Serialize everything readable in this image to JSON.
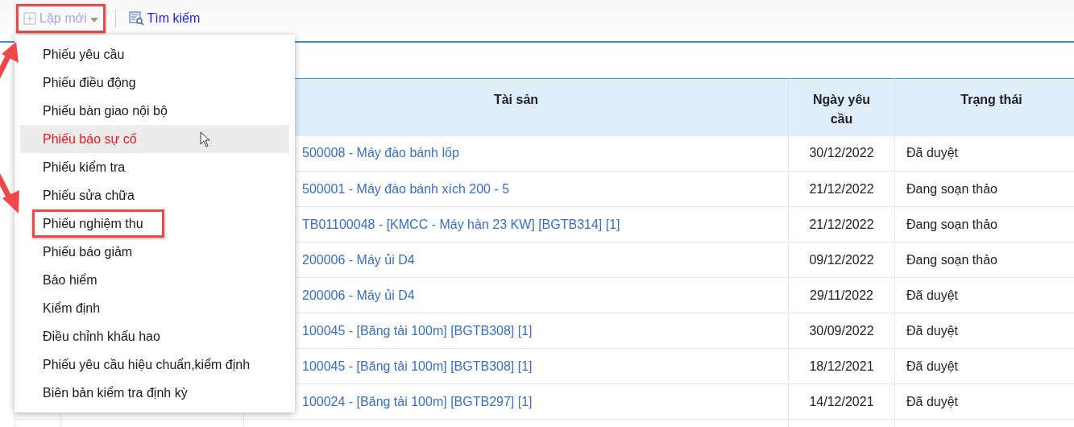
{
  "toolbar": {
    "buttons": [
      {
        "label": "Lập mới",
        "kind": "dropdown",
        "expanded": true,
        "annotated": true
      },
      {
        "label": "Tìm kiếm",
        "kind": "search",
        "annotated": false
      }
    ]
  },
  "menu": {
    "items": [
      {
        "label": "Phiếu yêu cầu",
        "selected": false,
        "annotated": false
      },
      {
        "label": "Phiếu điều động",
        "selected": false,
        "annotated": false
      },
      {
        "label": "Phiếu bàn giao nội bộ",
        "selected": false,
        "annotated": false
      },
      {
        "label": "Phiếu báo sự cố",
        "selected": true,
        "annotated": false
      },
      {
        "label": "Phiếu kiểm tra",
        "selected": false,
        "annotated": false
      },
      {
        "label": "Phiếu sửa chữa",
        "selected": false,
        "annotated": false
      },
      {
        "label": "Phiếu nghiệm thu",
        "selected": false,
        "annotated": true
      },
      {
        "label": "Phiếu báo giảm",
        "selected": false,
        "annotated": false
      },
      {
        "label": "Bảo hiểm",
        "selected": false,
        "annotated": false
      },
      {
        "label": "Kiểm định",
        "selected": false,
        "annotated": false
      },
      {
        "label": "Điều chỉnh khấu hao",
        "selected": false,
        "annotated": false
      },
      {
        "label": "Phiếu yêu cầu hiệu chuẩn,kiểm định",
        "selected": false,
        "annotated": false
      },
      {
        "label": "Biên bản kiểm tra định kỳ",
        "selected": false,
        "annotated": false
      }
    ]
  },
  "table": {
    "columns": [
      "Tài sản",
      "Ngày yêu cầu",
      "Trạng thái"
    ],
    "rows": [
      {
        "asset": "500008 - Máy đào bánh lốp",
        "date": "30/12/2022",
        "status": "Đã duyệt"
      },
      {
        "asset": "500001 - Máy đào bánh xích 200 - 5",
        "date": "21/12/2022",
        "status": "Đang soạn thảo"
      },
      {
        "asset": "TB01100048 - [KMCC - Máy hàn 23 KW] [BGTB314] [1]",
        "date": "21/12/2022",
        "status": "Đang soạn thảo"
      },
      {
        "asset": "200006 - Máy ủi D4",
        "date": "09/12/2022",
        "status": "Đang soạn thảo"
      },
      {
        "asset": "200006 - Máy ủi D4",
        "date": "29/11/2022",
        "status": "Đã duyệt"
      },
      {
        "asset": "100045 - [Băng tải 100m] [BGTB308] [1]",
        "date": "30/09/2022",
        "status": "Đã duyệt"
      },
      {
        "asset": "100045 - [Băng tải 100m] [BGTB308] [1]",
        "date": "18/12/2021",
        "status": "Đã duyệt"
      },
      {
        "asset": "100024 - [Băng tải 100m] [BGTB297] [1]",
        "date": "14/12/2021",
        "status": "Đã duyệt"
      }
    ]
  }
}
